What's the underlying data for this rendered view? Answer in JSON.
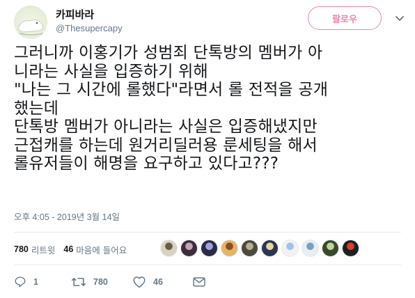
{
  "header": {
    "display_name": "카피바라",
    "handle": "@Thesupercapy",
    "follow_label": "팔로우"
  },
  "tweet": {
    "lines": [
      "그러니까 이홍기가 성범죄 단톡방의 멤버가 아",
      "니라는 사실을 입증하기 위해",
      "\"나는 그 시간에 롤했다\"라면서 롤 전적을 공개",
      "했는데",
      "단톡방 멤버가 아니라는 사실은 입증해냈지만",
      "근접캐를 하는데 원거리딜러용 룬세팅을 해서",
      "롤유저들이 해명을 요구하고 있다고???"
    ],
    "timestamp": "오후 4:05 - 2019년 3월 14일"
  },
  "stats": {
    "retweets_count": "780",
    "retweets_label": "리트윗",
    "likes_count": "46",
    "likes_label": "마음에 들어요"
  },
  "likers": [
    {
      "color": "#d9d2c3",
      "accent": "#6b5b45"
    },
    {
      "color": "#3b2e3a",
      "accent": "#c8a2b4"
    },
    {
      "color": "#2a2a48",
      "accent": "#9da3d8"
    },
    {
      "color": "#e5b36a",
      "accent": "#8a4f21"
    },
    {
      "color": "#4a4a3e",
      "accent": "#b8b092"
    },
    {
      "color": "#2d3550",
      "accent": "#e8d6a0"
    },
    {
      "color": "#f2f2f2",
      "accent": "#9fc3e8"
    },
    {
      "color": "#e8eef2",
      "accent": "#7aa0c0"
    },
    {
      "color": "#394a2c",
      "accent": "#c2d49a"
    },
    {
      "color": "#1f1f1f",
      "accent": "#d8402c"
    }
  ],
  "actions": {
    "reply_count": "1",
    "retweet_count": "780",
    "like_count": "46",
    "reply_icon": "reply-icon",
    "retweet_icon": "retweet-icon",
    "like_icon": "heart-icon",
    "dm_icon": "envelope-icon"
  },
  "colors": {
    "accent": "#e0245e",
    "secondary_text": "#657786",
    "divider": "#e6ecf0"
  }
}
